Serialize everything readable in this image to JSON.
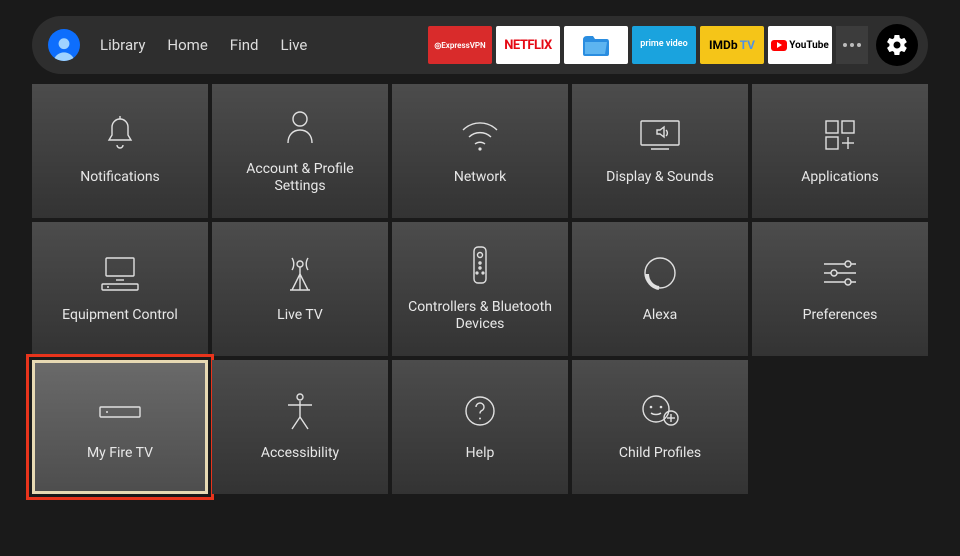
{
  "nav": {
    "items": [
      "Library",
      "Home",
      "Find",
      "Live"
    ]
  },
  "apps": {
    "expressvpn": "ExpressVPN",
    "netflix": "NETFLIX",
    "primevideo": "prime video",
    "imdb": "IMDb",
    "imdb_tv": "TV",
    "youtube": "YouTube"
  },
  "settings": {
    "tiles": [
      {
        "id": "notifications",
        "label": "Notifications"
      },
      {
        "id": "account",
        "label": "Account & Profile Settings"
      },
      {
        "id": "network",
        "label": "Network"
      },
      {
        "id": "display",
        "label": "Display & Sounds"
      },
      {
        "id": "applications",
        "label": "Applications"
      },
      {
        "id": "equipment",
        "label": "Equipment Control"
      },
      {
        "id": "livetv",
        "label": "Live TV"
      },
      {
        "id": "controllers",
        "label": "Controllers & Bluetooth Devices"
      },
      {
        "id": "alexa",
        "label": "Alexa"
      },
      {
        "id": "preferences",
        "label": "Preferences"
      },
      {
        "id": "myfiretv",
        "label": "My Fire TV"
      },
      {
        "id": "accessibility",
        "label": "Accessibility"
      },
      {
        "id": "help",
        "label": "Help"
      },
      {
        "id": "childprofiles",
        "label": "Child Profiles"
      }
    ]
  },
  "selected_tile": "myfiretv",
  "highlighted_tile": "myfiretv"
}
